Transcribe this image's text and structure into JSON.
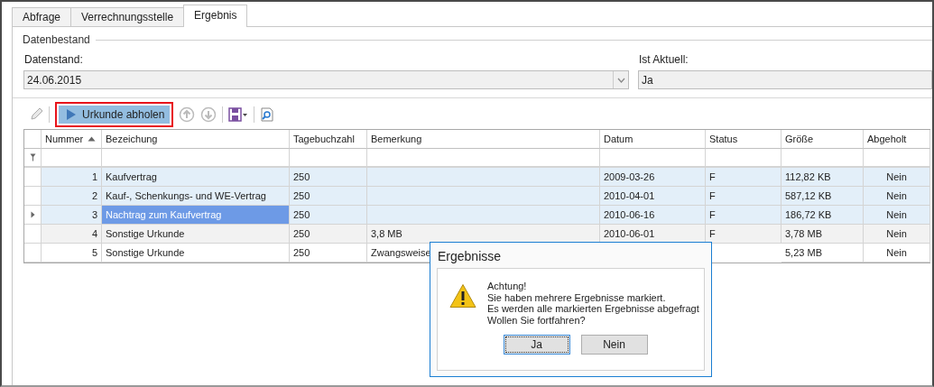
{
  "tabs": [
    {
      "label": "Abfrage",
      "selected": false
    },
    {
      "label": "Verrechnungsstelle",
      "selected": false
    },
    {
      "label": "Ergebnis",
      "selected": true
    }
  ],
  "group": {
    "title": "Datenbestand"
  },
  "fields": [
    {
      "label": "Datenstand:",
      "value": "24.06.2015",
      "kind": "dropdown"
    },
    {
      "label": "Ist Aktuell:",
      "value": "Ja",
      "kind": "text"
    }
  ],
  "toolbar": {
    "action_button": {
      "label": "Urkunde abholen",
      "highlighted": true
    }
  },
  "table": {
    "columns": [
      {
        "label": "Nummer",
        "sorted": true
      },
      {
        "label": "Bezeichung",
        "sorted": false
      },
      {
        "label": "Tagebuchzahl",
        "sorted": false
      },
      {
        "label": "Bemerkung",
        "sorted": false
      },
      {
        "label": "Datum",
        "sorted": false
      },
      {
        "label": "Status",
        "sorted": false
      },
      {
        "label": "Größe",
        "sorted": false
      },
      {
        "label": "Abgeholt",
        "sorted": false
      }
    ],
    "rows": [
      {
        "cells": [
          "1",
          "Kaufvertrag",
          "250",
          "",
          "2009-03-26",
          "F",
          "112,82 KB",
          "Nein"
        ],
        "selected": true,
        "focused": false
      },
      {
        "cells": [
          "2",
          "Kauf-, Schenkungs- und WE-Vertrag",
          "250",
          "",
          "2010-04-01",
          "F",
          "587,12 KB",
          "Nein"
        ],
        "selected": true,
        "focused": false
      },
      {
        "cells": [
          "3",
          "Nachtrag zum Kaufvertrag",
          "250",
          "",
          "2010-06-16",
          "F",
          "186,72 KB",
          "Nein"
        ],
        "selected": true,
        "focused": true
      },
      {
        "cells": [
          "4",
          "Sonstige Urkunde",
          "250",
          "3,8 MB",
          "2010-06-01",
          "F",
          "3,78 MB",
          "Nein"
        ],
        "selected": false,
        "focused": false
      },
      {
        "cells": [
          "5",
          "Sonstige Urkunde",
          "250",
          "Zwangsweise",
          null,
          null,
          "5,23 MB",
          "Nein"
        ],
        "selected": false,
        "focused": false
      }
    ]
  },
  "dialog": {
    "title": "Ergebnisse",
    "message": [
      "Achtung!",
      "Sie haben mehrere Ergebnisse markiert.",
      "Es werden alle markierten Ergebnisse abgefragt",
      "Wollen Sie fortfahren?"
    ],
    "buttons": [
      {
        "label": "Ja",
        "focused": true
      },
      {
        "label": "Nein",
        "focused": false
      }
    ]
  }
}
